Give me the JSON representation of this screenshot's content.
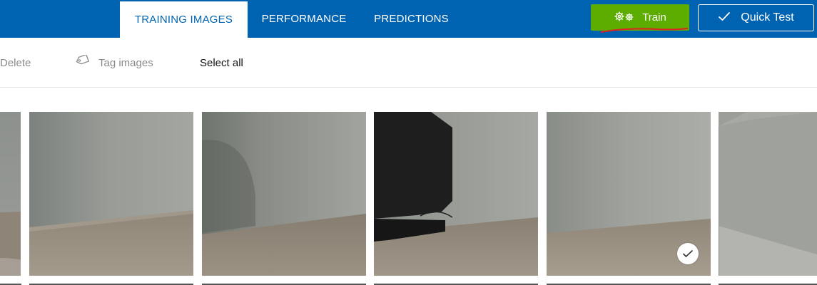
{
  "tabs": [
    {
      "label": "TRAINING IMAGES",
      "active": true
    },
    {
      "label": "PERFORMANCE",
      "active": false
    },
    {
      "label": "PREDICTIONS",
      "active": false
    }
  ],
  "actions": {
    "train_label": "Train",
    "train_icon": "gears-icon",
    "quick_test_label": "Quick Test",
    "quick_test_icon": "checkmark-icon"
  },
  "toolbar": {
    "delete_label": "Delete",
    "tag_label": "Tag images",
    "tag_icon": "tag-icon",
    "select_all_label": "Select all"
  },
  "images": [
    {
      "name": "image-thumbnail-1",
      "selected": false
    },
    {
      "name": "image-thumbnail-2",
      "selected": false
    },
    {
      "name": "image-thumbnail-3",
      "selected": false
    },
    {
      "name": "image-thumbnail-4",
      "selected": false
    },
    {
      "name": "image-thumbnail-5",
      "selected": true
    },
    {
      "name": "image-thumbnail-6",
      "selected": false
    }
  ],
  "colors": {
    "header": "#0063b1",
    "train_button": "#5cad00",
    "annotation": "#e02020"
  }
}
